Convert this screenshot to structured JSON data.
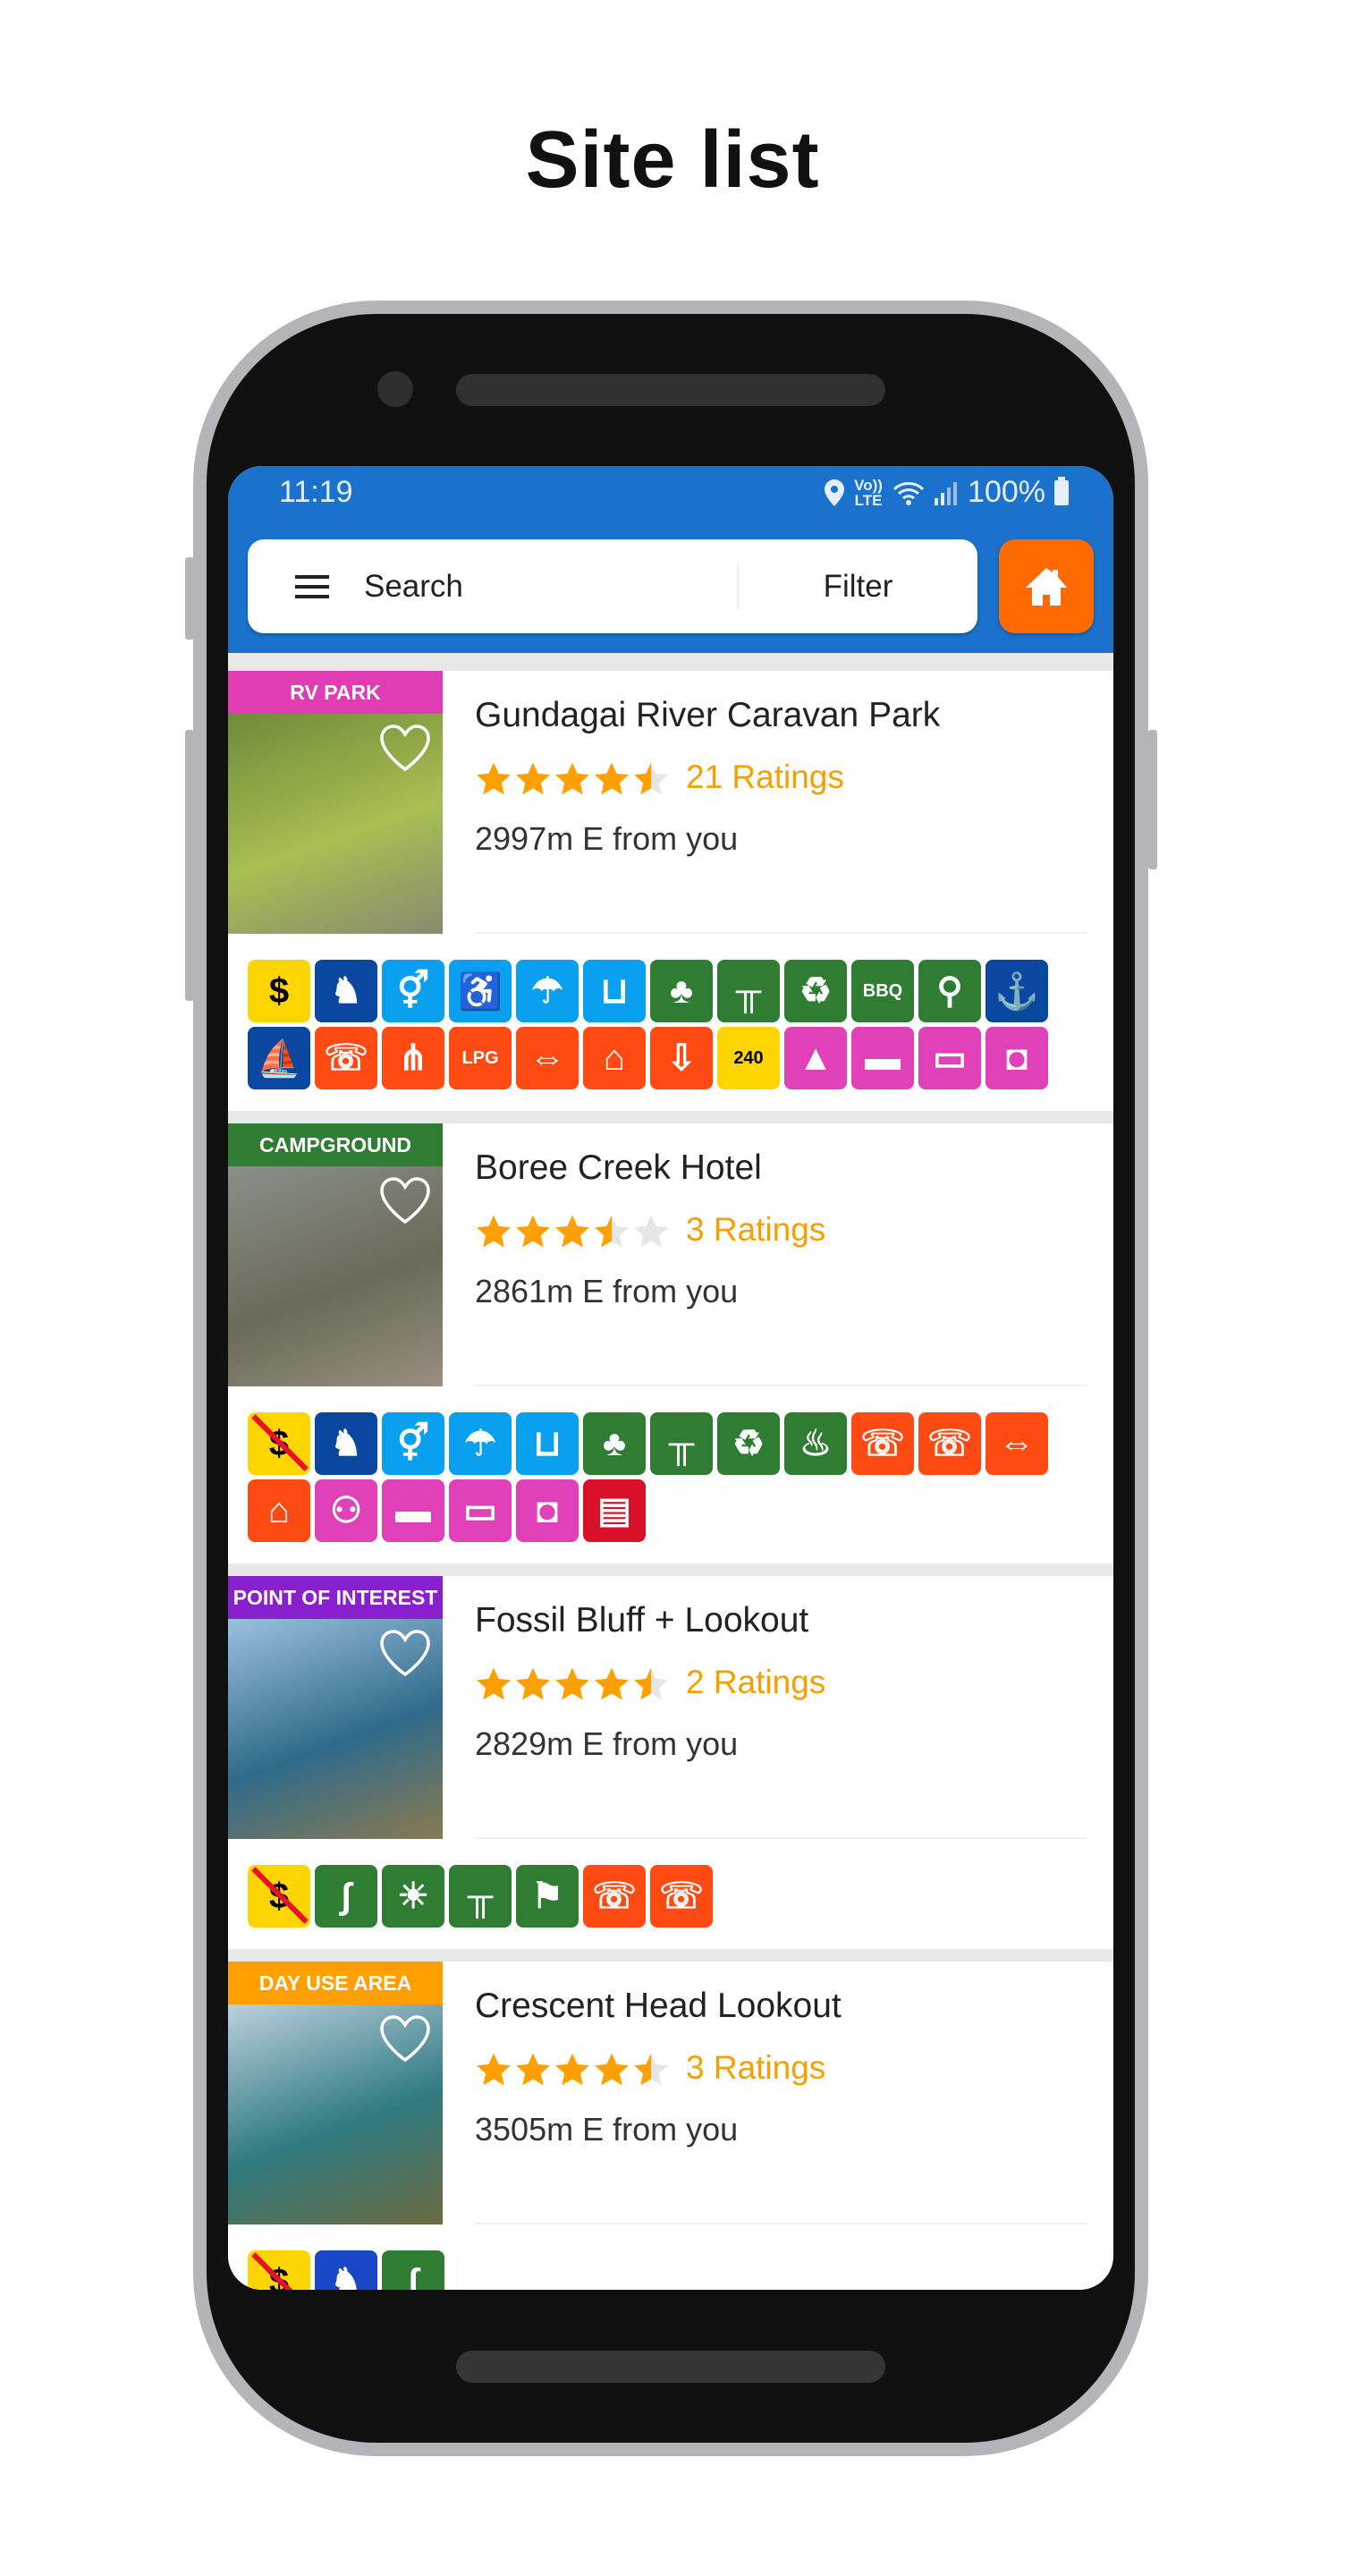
{
  "page_title": "Site list",
  "status_bar": {
    "time": "11:19",
    "network": "Vo)) LTE",
    "battery": "100%"
  },
  "search_bar": {
    "menu_icon": "hamburger-menu-icon",
    "search_label": "Search",
    "filter_label": "Filter",
    "home_icon": "home-icon"
  },
  "colors": {
    "header": "#1a72cc",
    "home_button": "#ff6a00",
    "star": "#ffa000",
    "star_empty": "#e6e6e6",
    "ratings_text": "#f5a000",
    "yellow": "#ffd500",
    "navy": "#0a47a0",
    "blue": "#0aa0f0",
    "green": "#2e7d32",
    "orange": "#ff4a14",
    "magenta": "#e040b8",
    "red": "#d8102a",
    "royal": "#1a46c8"
  },
  "sites": [
    {
      "category": "RV PARK",
      "category_color": "#e03cb4",
      "name": "Gundagai River Caravan Park",
      "rating": 4.5,
      "ratings_label": "21 Ratings",
      "distance": "2997m E from you",
      "favorite": false,
      "photo": [
        "#6f8a3a",
        "#a7bf52",
        "#8a8a70"
      ],
      "facilities": [
        {
          "icon": "fee-dollar-icon",
          "color": "yellow"
        },
        {
          "icon": "dog-friendly-icon",
          "color": "navy"
        },
        {
          "icon": "toilets-icon",
          "color": "blue"
        },
        {
          "icon": "wheelchair-access-icon",
          "color": "blue"
        },
        {
          "icon": "shower-icon",
          "color": "blue"
        },
        {
          "icon": "drinking-water-icon",
          "color": "blue"
        },
        {
          "icon": "shade-tree-icon",
          "color": "green"
        },
        {
          "icon": "picnic-table-icon",
          "color": "green"
        },
        {
          "icon": "rubbish-bin-icon",
          "color": "green"
        },
        {
          "icon": "bbq-icon",
          "color": "green",
          "text": "BBQ"
        },
        {
          "icon": "playground-icon",
          "color": "green"
        },
        {
          "icon": "fishing-icon",
          "color": "navy"
        },
        {
          "icon": "boat-ramp-icon",
          "color": "navy"
        },
        {
          "icon": "telstra-signal-icon",
          "color": "orange"
        },
        {
          "icon": "tv-antenna-icon",
          "color": "orange"
        },
        {
          "icon": "lpg-icon",
          "color": "orange",
          "text": "LPG"
        },
        {
          "icon": "big-rig-icon",
          "color": "orange"
        },
        {
          "icon": "cabin-icon",
          "color": "orange"
        },
        {
          "icon": "dump-point-icon",
          "color": "orange"
        },
        {
          "icon": "power-240-icon",
          "color": "yellow",
          "text": "240"
        },
        {
          "icon": "tent-icon",
          "color": "magenta"
        },
        {
          "icon": "motorhome-icon",
          "color": "magenta"
        },
        {
          "icon": "camper-trailer-icon",
          "color": "magenta"
        },
        {
          "icon": "caravan-icon",
          "color": "magenta"
        }
      ]
    },
    {
      "category": "CAMPGROUND",
      "category_color": "#2e7d32",
      "name": "Boree Creek Hotel",
      "rating": 3.5,
      "ratings_label": "3 Ratings",
      "distance": "2861m E from you",
      "favorite": false,
      "photo": [
        "#8a8f86",
        "#6b6a5a",
        "#9a8e80"
      ],
      "facilities": [
        {
          "icon": "free-no-fee-icon",
          "color": "yellow"
        },
        {
          "icon": "dog-friendly-icon",
          "color": "navy"
        },
        {
          "icon": "toilets-icon",
          "color": "blue"
        },
        {
          "icon": "shower-icon",
          "color": "blue"
        },
        {
          "icon": "drinking-water-icon",
          "color": "blue"
        },
        {
          "icon": "shade-tree-icon",
          "color": "green"
        },
        {
          "icon": "picnic-table-icon",
          "color": "green"
        },
        {
          "icon": "rubbish-bin-icon",
          "color": "green"
        },
        {
          "icon": "fire-pit-icon",
          "color": "green"
        },
        {
          "icon": "telstra-signal-icon",
          "color": "orange"
        },
        {
          "icon": "phone-signal-icon",
          "color": "orange"
        },
        {
          "icon": "big-rig-icon",
          "color": "orange"
        },
        {
          "icon": "cabin-icon",
          "color": "orange"
        },
        {
          "icon": "motorbike-icon",
          "color": "magenta"
        },
        {
          "icon": "motorhome-icon",
          "color": "magenta"
        },
        {
          "icon": "camper-trailer-icon",
          "color": "magenta"
        },
        {
          "icon": "caravan-icon",
          "color": "magenta"
        },
        {
          "icon": "bus-icon",
          "color": "red"
        }
      ]
    },
    {
      "category": "POINT OF INTEREST",
      "category_color": "#8a1fd0",
      "name": "Fossil Bluff + Lookout",
      "rating": 4.5,
      "ratings_label": "2 Ratings",
      "distance": "2829m E from you",
      "favorite": false,
      "photo": [
        "#9cc0e0",
        "#2f6a8a",
        "#8a7a50"
      ],
      "facilities": [
        {
          "icon": "free-no-fee-icon",
          "color": "yellow"
        },
        {
          "icon": "walking-trail-icon",
          "color": "green"
        },
        {
          "icon": "scenic-view-icon",
          "color": "green"
        },
        {
          "icon": "picnic-table-icon",
          "color": "green"
        },
        {
          "icon": "hiking-icon",
          "color": "green"
        },
        {
          "icon": "telstra-signal-icon",
          "color": "orange"
        },
        {
          "icon": "phone-signal-icon",
          "color": "orange"
        }
      ]
    },
    {
      "category": "DAY USE AREA",
      "category_color": "#ffa000",
      "name": "Crescent Head Lookout",
      "rating": 4.5,
      "ratings_label": "3 Ratings",
      "distance": "3505m E from you",
      "favorite": false,
      "photo": [
        "#bcd0e0",
        "#2f7a80",
        "#6a6a40"
      ],
      "facilities": [
        {
          "icon": "free-no-fee-icon",
          "color": "yellow"
        },
        {
          "icon": "dog-friendly-icon",
          "color": "royal"
        },
        {
          "icon": "walking-trail-icon",
          "color": "green"
        }
      ]
    }
  ]
}
